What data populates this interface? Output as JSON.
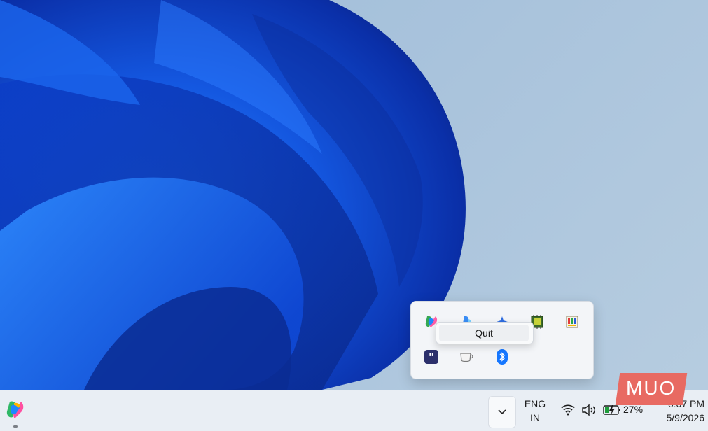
{
  "tray": {
    "context_menu": {
      "quit_label": "Quit"
    },
    "row1_icons": [
      "copilot-icon",
      "copilot-alt-icon",
      "sparkle-icon",
      "chip-icon",
      "palette-icon"
    ],
    "row2_icons": [
      "quote-app-icon",
      "coffee-cup-icon",
      "bluetooth-icon"
    ]
  },
  "taskbar": {
    "language": {
      "line1": "ENG",
      "line2": "IN"
    },
    "battery_percent": "27%",
    "time": "6:07 PM",
    "date": "5/9/2026"
  },
  "watermark": {
    "text": "MUO"
  },
  "colors": {
    "wallpaper_blue": "#1a5fe6",
    "taskbar_bg": "#e9eef4",
    "flyout_bg": "#f3f5f8",
    "bluetooth_blue": "#1677ff",
    "watermark_red": "#e86a62"
  }
}
